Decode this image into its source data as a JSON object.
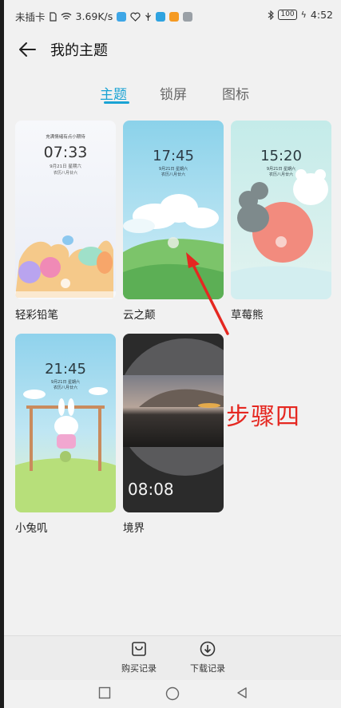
{
  "status_bar": {
    "carrier": "未插卡",
    "network_speed": "3.69K/s",
    "battery": "100",
    "time": "4:52"
  },
  "header": {
    "back_icon": "arrow-left-icon",
    "title": "我的主题"
  },
  "tabs": [
    {
      "label": "主题",
      "active": true
    },
    {
      "label": "锁屏",
      "active": false
    },
    {
      "label": "图标",
      "active": false
    }
  ],
  "themes": [
    {
      "name": "轻彩铅笔",
      "clock": "07:33",
      "date": "9月21日 星期六",
      "sub": "农历八月廿六",
      "top_text": "充满情绪有点小期待",
      "accent": "#f0a8a0"
    },
    {
      "name": "云之颠",
      "clock": "17:45",
      "date": "9月21日 星期六",
      "sub": "农历八月廿六",
      "accent": "#8fd0e8"
    },
    {
      "name": "草莓熊",
      "clock": "15:20",
      "date": "9月21日 星期六",
      "sub": "农历八月廿六",
      "accent": "#f08a80"
    },
    {
      "name": "小兔叽",
      "clock": "21:45",
      "date": "9月21日 星期六",
      "sub": "农历八月廿六",
      "accent": "#a6dc7a"
    },
    {
      "name": "境界",
      "clock": "08:08",
      "accent": "#2c2c2c"
    }
  ],
  "annotation": {
    "label": "步骤四",
    "color": "#e52821"
  },
  "bottom_bar": {
    "purchase": {
      "label": "购买记录",
      "icon": "purchase-bag-icon"
    },
    "download": {
      "label": "下载记录",
      "icon": "download-icon"
    }
  },
  "nav_bar": {
    "back": "triangle-back-icon",
    "home": "circle-home-icon",
    "recents": "square-recents-icon"
  }
}
